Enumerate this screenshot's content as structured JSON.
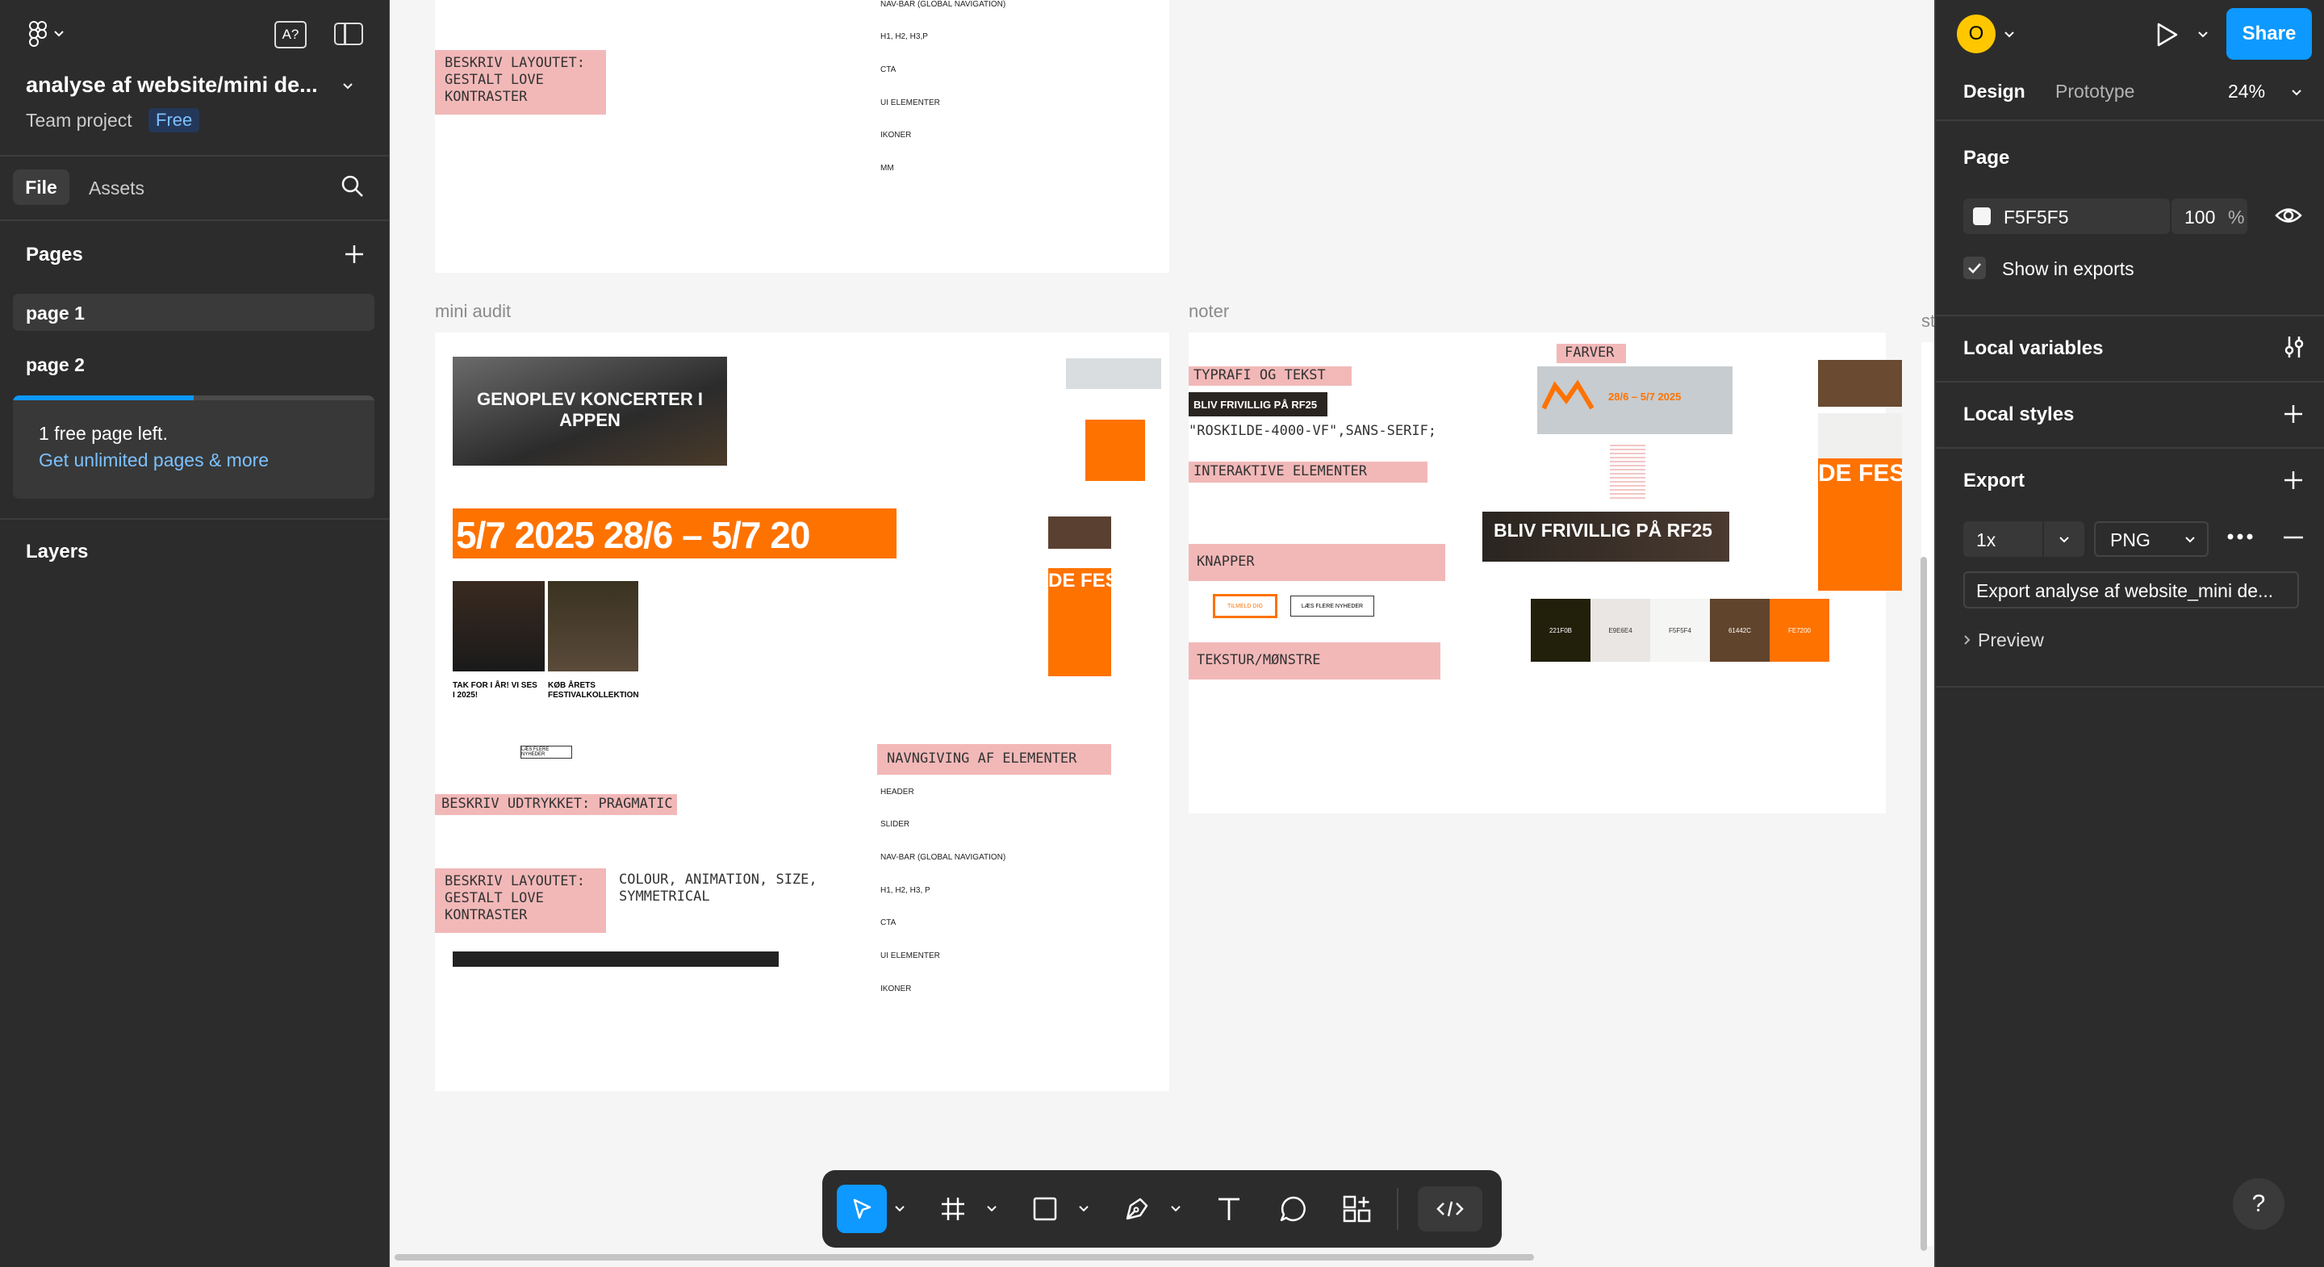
{
  "file": {
    "title": "analyse af website/mini de...",
    "team": "Team project",
    "plan_badge": "Free"
  },
  "left_tabs": {
    "file": "File",
    "assets": "Assets"
  },
  "pages": {
    "heading": "Pages",
    "items": [
      {
        "label": "page 1"
      },
      {
        "label": "page 2"
      }
    ],
    "upsell_text": "1 free page left.",
    "upsell_link": "Get unlimited pages & more",
    "progress": 0.5
  },
  "layers": {
    "heading": "Layers"
  },
  "header": {
    "avatar_initial": "O",
    "share_label": "Share"
  },
  "right_tabs": {
    "design": "Design",
    "prototype": "Prototype",
    "zoom": "24%"
  },
  "page_section": {
    "heading": "Page",
    "color_hex": "F5F5F5",
    "opacity": "100",
    "percent": "%",
    "show_in_exports": "Show in exports",
    "bg_color": "#f5f5f5"
  },
  "local_variables": "Local variables",
  "local_styles": "Local styles",
  "export": {
    "heading": "Export",
    "scale": "1x",
    "format": "PNG",
    "button": "Export analyse af website_mini de...",
    "preview": "Preview"
  },
  "help": "?",
  "canvas": {
    "frame_labels": {
      "mini_audit": "mini audit",
      "noter": "noter",
      "partial": "st"
    },
    "top_frame": {
      "note_layout": "BESKRIV LAYOUTET:\nGESTALT LOVE\nKONTRASTER",
      "list": [
        "NAV-BAR (GLOBAL NAVIGATION)",
        "H1, H2, H3,P",
        "CTA",
        "UI ELEMENTER",
        "IKONER",
        "MM"
      ]
    },
    "mini_audit": {
      "hero_text": "GENOPLEV KONCERTER I APPEN",
      "banner_text": "5/7 2025   28/6 – 5/7 20",
      "card1_title": "TAK FOR I ÅR! VI SES I 2025!",
      "card2_title": "KØB ÅRETS FESTIVALKOLLEKTION",
      "more_button": "LÆS FLERE NYHEDER",
      "de_fest": "DE FEST",
      "note_expression": "BESKRIV UDTRYKKET: PRAGMATIC",
      "note_layout": "BESKRIV LAYOUTET:\nGESTALT LOVE\nKONTRASTER",
      "note_colour": "COLOUR, ANIMATION, SIZE,\nSYMMETRICAL",
      "note_naming": "NAVNGIVING AF ELEMENTER",
      "naming_list": [
        "HEADER",
        "SLIDER",
        "NAV-BAR (GLOBAL NAVIGATION)",
        "H1, H2, H3, P",
        "CTA",
        "UI ELEMENTER",
        "IKONER"
      ]
    },
    "noter": {
      "typo": "TYPRAFI OG TEKST",
      "bliv_small": "BLIV FRIVILLIG PÅ RF25",
      "font_name": "\"ROSKILDE-4000-VF\",SANS-SERIF;",
      "interactive": "INTERAKTIVE ELEMENTER",
      "knapper": "KNAPPER",
      "btn_primary": "TILMELD DIG",
      "btn_secondary": "LÆS FLERE NYHEDER",
      "texture": "TEKSTUR/MØNSTRE",
      "farver": "FARVER",
      "date_small": "28/6 – 5/7 2025",
      "bliv_big": "BLIV FRIVILLIG PÅ RF25",
      "de_fest": "DE FEST",
      "swatches": [
        {
          "hex": "221F0B",
          "color": "#221f0b",
          "text": "#ffffff"
        },
        {
          "hex": "E9E6E4",
          "color": "#e9e6e4",
          "text": "#333333"
        },
        {
          "hex": "F5F5F4",
          "color": "#f5f5f4",
          "text": "#333333"
        },
        {
          "hex": "61442C",
          "color": "#61442c",
          "text": "#ffffff"
        },
        {
          "hex": "FE7200",
          "color": "#fe7200",
          "text": "#ffffff"
        }
      ]
    }
  },
  "accent": "#0d99ff",
  "orange": "#fe7200"
}
